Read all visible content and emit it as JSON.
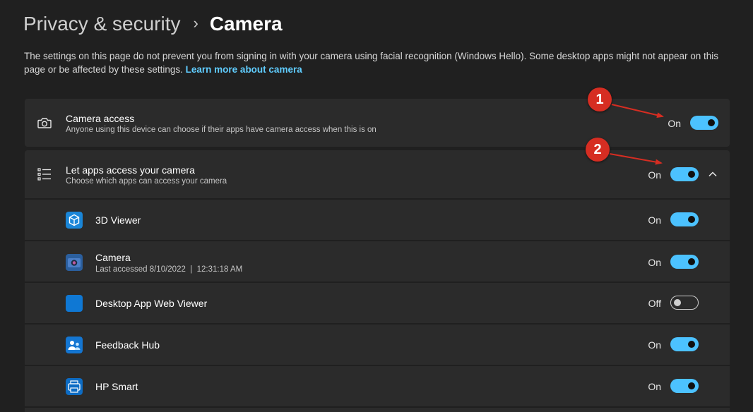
{
  "breadcrumb": {
    "parent": "Privacy & security",
    "separator": "›",
    "current": "Camera"
  },
  "description": {
    "text": "The settings on this page do not prevent you from signing in with your camera using facial recognition (Windows Hello). Some desktop apps might not appear on this page or be affected by these settings. ",
    "link": "Learn more about camera"
  },
  "camera_access": {
    "title": "Camera access",
    "subtitle": "Anyone using this device can choose if their apps have camera access when this is on",
    "state": "On",
    "icon": "camera-icon"
  },
  "let_apps": {
    "title": "Let apps access your camera",
    "subtitle": "Choose which apps can access your camera",
    "state": "On",
    "icon": "list-icon",
    "chevron": "chevron-up-icon"
  },
  "apps": [
    {
      "name": "3D Viewer",
      "subtitle": "",
      "state": "On",
      "icon": "3d-viewer-icon"
    },
    {
      "name": "Camera",
      "subtitle": "Last accessed 8/10/2022  |  12:31:18 AM",
      "state": "On",
      "icon": "camera-app-icon"
    },
    {
      "name": "Desktop App Web Viewer",
      "subtitle": "",
      "state": "Off",
      "icon": "desktop-app-web-viewer-icon"
    },
    {
      "name": "Feedback Hub",
      "subtitle": "",
      "state": "On",
      "icon": "feedback-hub-icon"
    },
    {
      "name": "HP Smart",
      "subtitle": "",
      "state": "On",
      "icon": "hp-smart-icon"
    }
  ],
  "annotations": [
    "1",
    "2"
  ],
  "colors": {
    "background": "#202020",
    "card": "#2b2b2b",
    "accent": "#4cc2ff",
    "link": "#60cdff",
    "badge": "#d62d22",
    "arrow": "#d62d22"
  }
}
